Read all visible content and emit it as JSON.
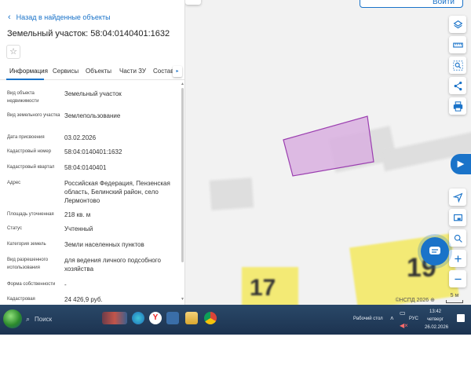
{
  "panel": {
    "back_label": "Назад в найденные объекты",
    "title": "Земельный участок: 58:04:0140401:1632",
    "tabs": [
      "Информация",
      "Сервисы",
      "Объекты",
      "Части ЗУ",
      "Состав"
    ],
    "attributes": [
      {
        "label": "Вид объекта недвижимости",
        "value": "Земельный участок"
      },
      {
        "label": "Вид земельного участка",
        "value": "Землепользование"
      },
      {
        "label": "Дата присвоения",
        "value": "03.02.2026"
      },
      {
        "label": "Кадастровый номер",
        "value": "58:04:0140401:1632"
      },
      {
        "label": "Кадастровый квартал",
        "value": "58:04:0140401"
      },
      {
        "label": "Адрес",
        "value": "Российская Федерация, Пензенская область, Белинский район, село Лермонтово"
      },
      {
        "label": "Площадь уточненная",
        "value": "218 кв. м"
      },
      {
        "label": "Статус",
        "value": "Учтенный"
      },
      {
        "label": "Категория земель",
        "value": "Земли населенных пунктов"
      },
      {
        "label": "Вид разрешенного использования",
        "value": "для ведения личного подсобного хозяйства"
      },
      {
        "label": "Форма собственности",
        "value": "-"
      },
      {
        "label": "Кадастровая",
        "value": "24 426,9 руб."
      }
    ]
  },
  "map": {
    "login_label": "Войти",
    "house_numbers": [
      "17",
      "19"
    ],
    "copyright": "©НСПД 2026 ⊕",
    "scale_label": "5 м",
    "parcel_color": "#d9b0e0",
    "parcel_border": "#9b3fb0",
    "right_buttons": [
      "layers-icon",
      "ruler-icon",
      "search-area-icon",
      "share-icon",
      "print-icon"
    ],
    "lower_buttons": [
      "locate-icon",
      "screen-icon",
      "zoom-area-icon",
      "zoom-in-icon",
      "zoom-out-icon"
    ]
  },
  "taskbar": {
    "search_placeholder": "Поиск",
    "desktop_label": "Рабочий стол",
    "lang": "РУС",
    "time": "13:42",
    "day": "четверг",
    "date": "26.02.2026"
  },
  "colors": {
    "accent": "#1a73c9",
    "taskbar": "#1f3b5c",
    "house_zone": "#f3ea75"
  }
}
